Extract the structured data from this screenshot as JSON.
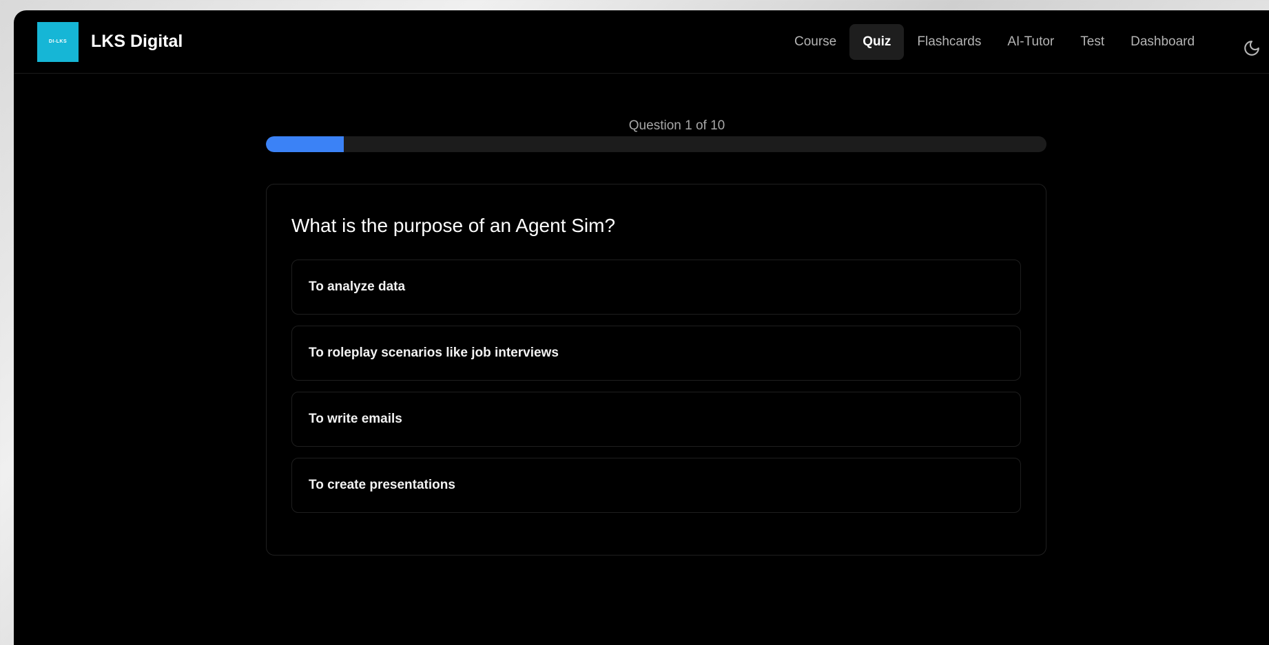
{
  "brand": {
    "logo_text": "DI-LKS",
    "name": "LKS Digital"
  },
  "nav": {
    "items": [
      {
        "label": "Course"
      },
      {
        "label": "Quiz"
      },
      {
        "label": "Flashcards"
      },
      {
        "label": "AI-Tutor"
      },
      {
        "label": "Test"
      },
      {
        "label": "Dashboard"
      }
    ],
    "active_index": 1,
    "theme_icon": "moon-icon"
  },
  "quiz": {
    "progress_label": "Question 1 of 10",
    "progress_fraction": 0.1,
    "question": "What is the purpose of an Agent Sim?",
    "options": [
      {
        "label": "To analyze data"
      },
      {
        "label": "To roleplay scenarios like job interviews"
      },
      {
        "label": "To write emails"
      },
      {
        "label": "To create presentations"
      }
    ]
  },
  "colors": {
    "accent": "#3b82f6",
    "logo_bg": "#16b6d6",
    "background": "#000000"
  }
}
